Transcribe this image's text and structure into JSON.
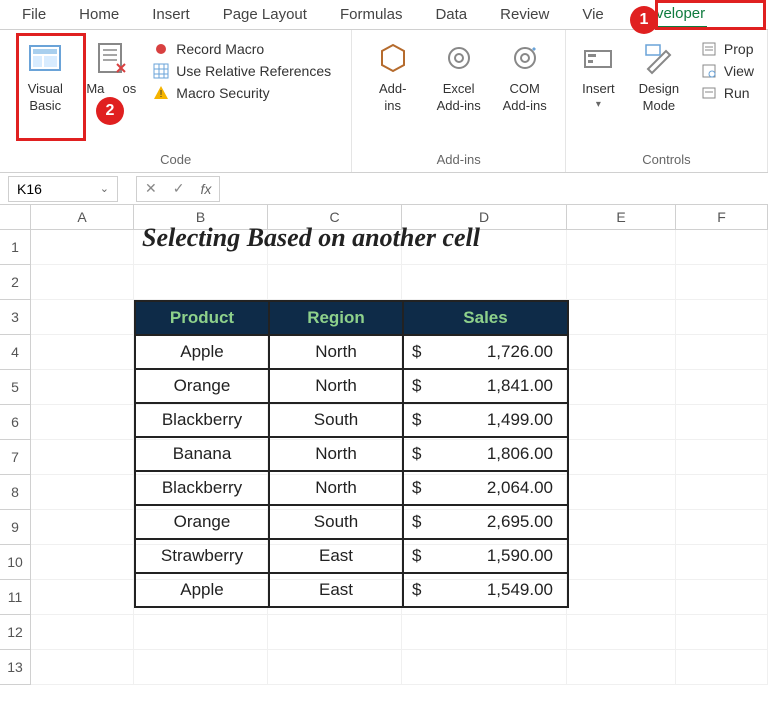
{
  "tabs": {
    "file": "File",
    "home": "Home",
    "insert": "Insert",
    "page_layout": "Page Layout",
    "formulas": "Formulas",
    "data": "Data",
    "review": "Review",
    "view": "Vie",
    "developer": "Developer"
  },
  "ribbon": {
    "code": {
      "visual_basic": "Visual\nBasic",
      "macros": "Ma     os",
      "record": "Record Macro",
      "relative": "Use Relative References",
      "security": "Macro Security",
      "group": "Code"
    },
    "addins": {
      "addins": "Add-\nins",
      "excel": "Excel\nAdd-ins",
      "com": "COM\nAdd-ins",
      "group": "Add-ins"
    },
    "controls": {
      "insert": "Insert",
      "design": "Design\nMode",
      "prop": "Prop",
      "view": "View",
      "run": "Run",
      "group": "Controls"
    }
  },
  "namebox": "K16",
  "cols": [
    "A",
    "B",
    "C",
    "D",
    "E",
    "F"
  ],
  "rowlabels": [
    "1",
    "2",
    "3",
    "4",
    "5",
    "6",
    "7",
    "8",
    "9",
    "10",
    "11",
    "12",
    "13"
  ],
  "title": "Selecting Based on another cell",
  "headers": {
    "product": "Product",
    "region": "Region",
    "sales": "Sales"
  },
  "data": [
    {
      "p": "Apple",
      "r": "North",
      "s": "1,726.00"
    },
    {
      "p": "Orange",
      "r": "North",
      "s": "1,841.00"
    },
    {
      "p": "Blackberry",
      "r": "South",
      "s": "1,499.00"
    },
    {
      "p": "Banana",
      "r": "North",
      "s": "1,806.00"
    },
    {
      "p": "Blackberry",
      "r": "North",
      "s": "2,064.00"
    },
    {
      "p": "Orange",
      "r": "South",
      "s": "2,695.00"
    },
    {
      "p": "Strawberry",
      "r": "East",
      "s": "1,590.00"
    },
    {
      "p": "Apple",
      "r": "East",
      "s": "1,549.00"
    }
  ],
  "badge1": "1",
  "badge2": "2",
  "dollar": "$"
}
